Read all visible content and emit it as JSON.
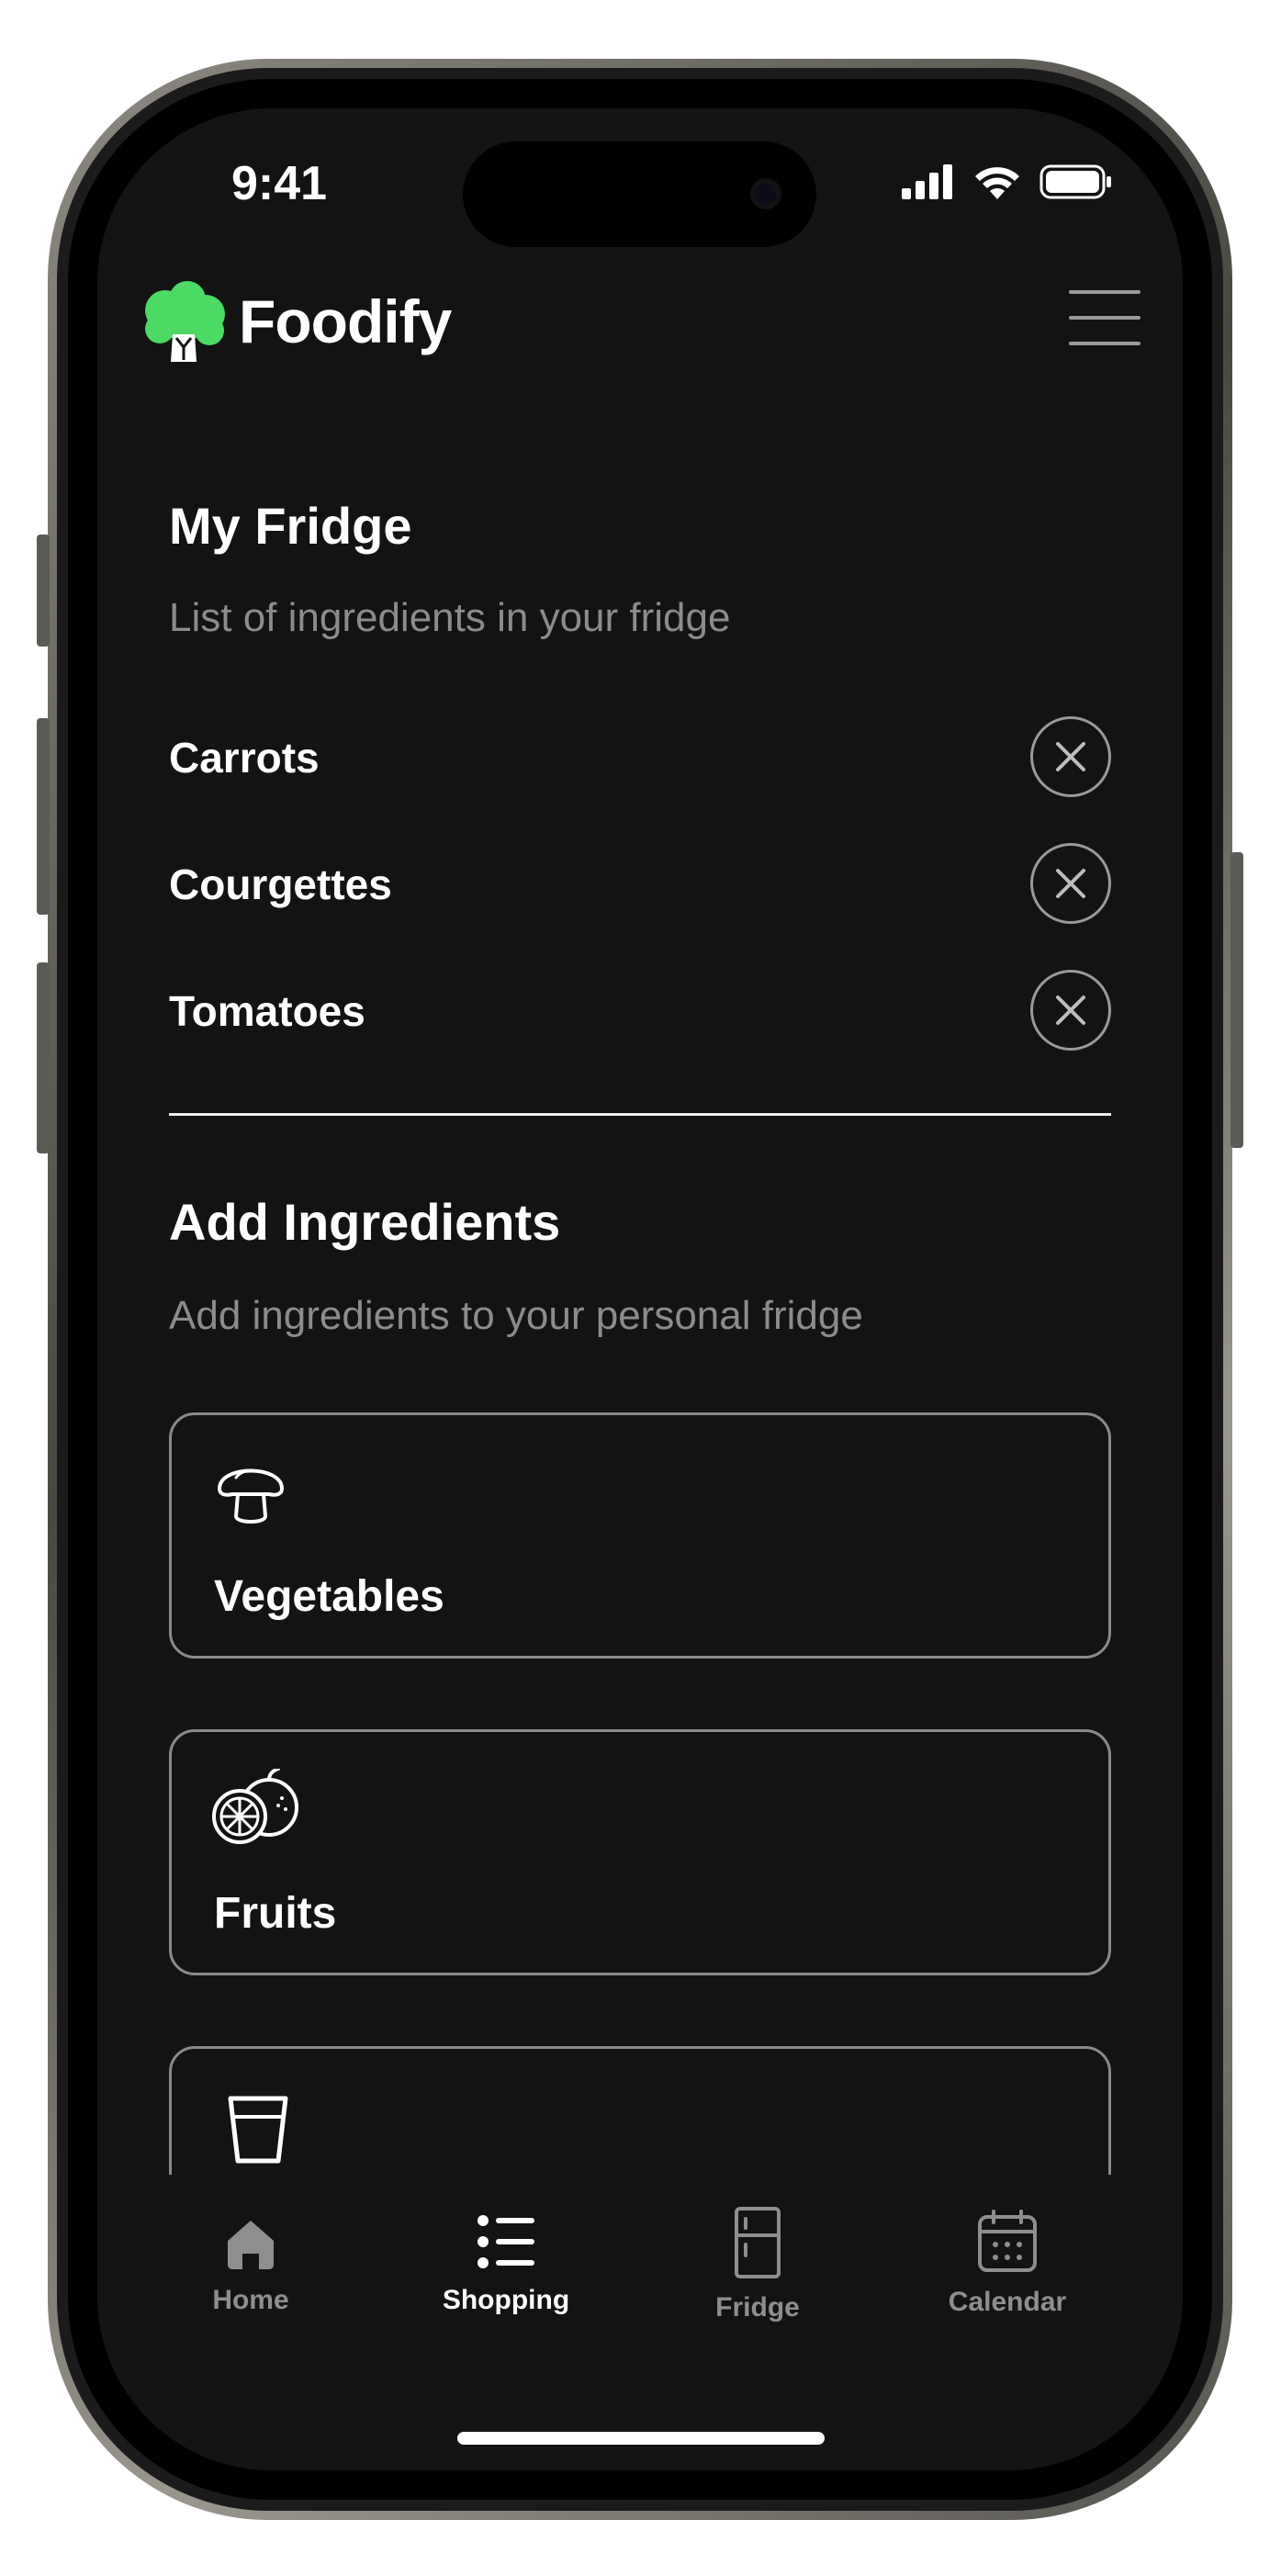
{
  "status_bar": {
    "time": "9:41"
  },
  "app": {
    "name": "Foodify",
    "brand_color": "#4cd964"
  },
  "fridge": {
    "title": "My Fridge",
    "subtitle": "List of ingredients in your fridge",
    "items": [
      {
        "name": "Carrots"
      },
      {
        "name": "Courgettes"
      },
      {
        "name": "Tomatoes"
      }
    ]
  },
  "add": {
    "title": "Add Ingredients",
    "subtitle": "Add ingredients to your personal fridge",
    "categories": [
      {
        "label": "Vegetables",
        "icon": "mushroom-icon"
      },
      {
        "label": "Fruits",
        "icon": "orange-icon"
      },
      {
        "label": "",
        "icon": "glass-icon"
      }
    ]
  },
  "tabbar": {
    "active": "Shopping",
    "tabs": [
      {
        "label": "Home",
        "icon": "home-icon"
      },
      {
        "label": "Shopping",
        "icon": "list-icon"
      },
      {
        "label": "Fridge",
        "icon": "fridge-icon"
      },
      {
        "label": "Calendar",
        "icon": "calendar-icon"
      }
    ],
    "active_color": "#ffffff",
    "inactive_color": "#8e8e8e"
  }
}
